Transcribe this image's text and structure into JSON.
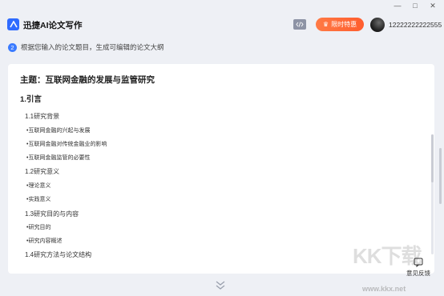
{
  "window": {
    "minimize": "—",
    "restore": "□",
    "close": "✕"
  },
  "header": {
    "app_title": "迅捷AI论文写作",
    "promo_label": "限时特惠",
    "username": "12222222222555"
  },
  "step": {
    "number": "2",
    "text": "根据您输入的论文题目，生成可编辑的论文大纲"
  },
  "outline": {
    "topic": "主题：互联网金融的发展与监管研究",
    "items": [
      {
        "level": 1,
        "text": "1.引言"
      },
      {
        "level": 2,
        "text": "1.1研究背景"
      },
      {
        "level": 3,
        "text": "•互联网金融的兴起与发展"
      },
      {
        "level": 3,
        "text": "•互联网金融对传统金融业的影响"
      },
      {
        "level": 3,
        "text": "•互联网金融监管的必要性"
      },
      {
        "level": 2,
        "text": "1.2研究意义"
      },
      {
        "level": 3,
        "text": "•理论意义"
      },
      {
        "level": 3,
        "text": "•实践意义"
      },
      {
        "level": 2,
        "text": "1.3研究目的与内容"
      },
      {
        "level": 3,
        "text": "•研究目的"
      },
      {
        "level": 3,
        "text": "•研究内容概述"
      },
      {
        "level": 2,
        "text": "1.4研究方法与论文结构"
      }
    ]
  },
  "feedback_label": "意见反馈",
  "watermark": {
    "text": "KK下载",
    "url": "www.kkx.net"
  },
  "colors": {
    "accent": "#3b7bff",
    "promo": "#ff6a3a",
    "background": "#eef0f5"
  }
}
